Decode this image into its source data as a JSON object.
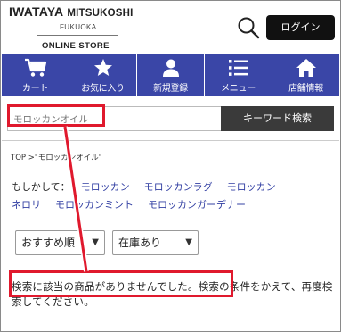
{
  "header": {
    "brand_iwataya": "IWATAYA",
    "brand_mitsukoshi": "MITSUKOSHI",
    "brand_city": "FUKUOKA",
    "brand_store": "ONLINE STORE",
    "login_label": "ログイン"
  },
  "nav": {
    "items": [
      {
        "label": "カート",
        "icon": "cart-icon"
      },
      {
        "label": "お気に入り",
        "icon": "star-icon"
      },
      {
        "label": "新規登録",
        "icon": "user-icon"
      },
      {
        "label": "メニュー",
        "icon": "list-menu-icon"
      },
      {
        "label": "店舗情報",
        "icon": "store-icon"
      }
    ]
  },
  "search": {
    "value": "モロッカンオイル",
    "button_label": "キーワード検索"
  },
  "breadcrumb": "TOP >\"モロッカンオイル\"",
  "suggestions": {
    "label": "もしかして：",
    "items": [
      "モロッカン",
      "モロッカンラグ",
      "モロッカン",
      "ネロリ",
      "モロッカンミント",
      "モロッカンガーデナー"
    ]
  },
  "sort": {
    "selected": "おすすめ順",
    "stock_selected": "在庫あり"
  },
  "results": {
    "message_highlight": "検索に該当の商品がありませんでした。",
    "message_rest": "検索の条件をかえて、再度検索してください。"
  },
  "colors": {
    "nav_bg": "#3a46a7",
    "link": "#3340a3",
    "annotation": "#e0192d",
    "button_dark": "#111111"
  }
}
